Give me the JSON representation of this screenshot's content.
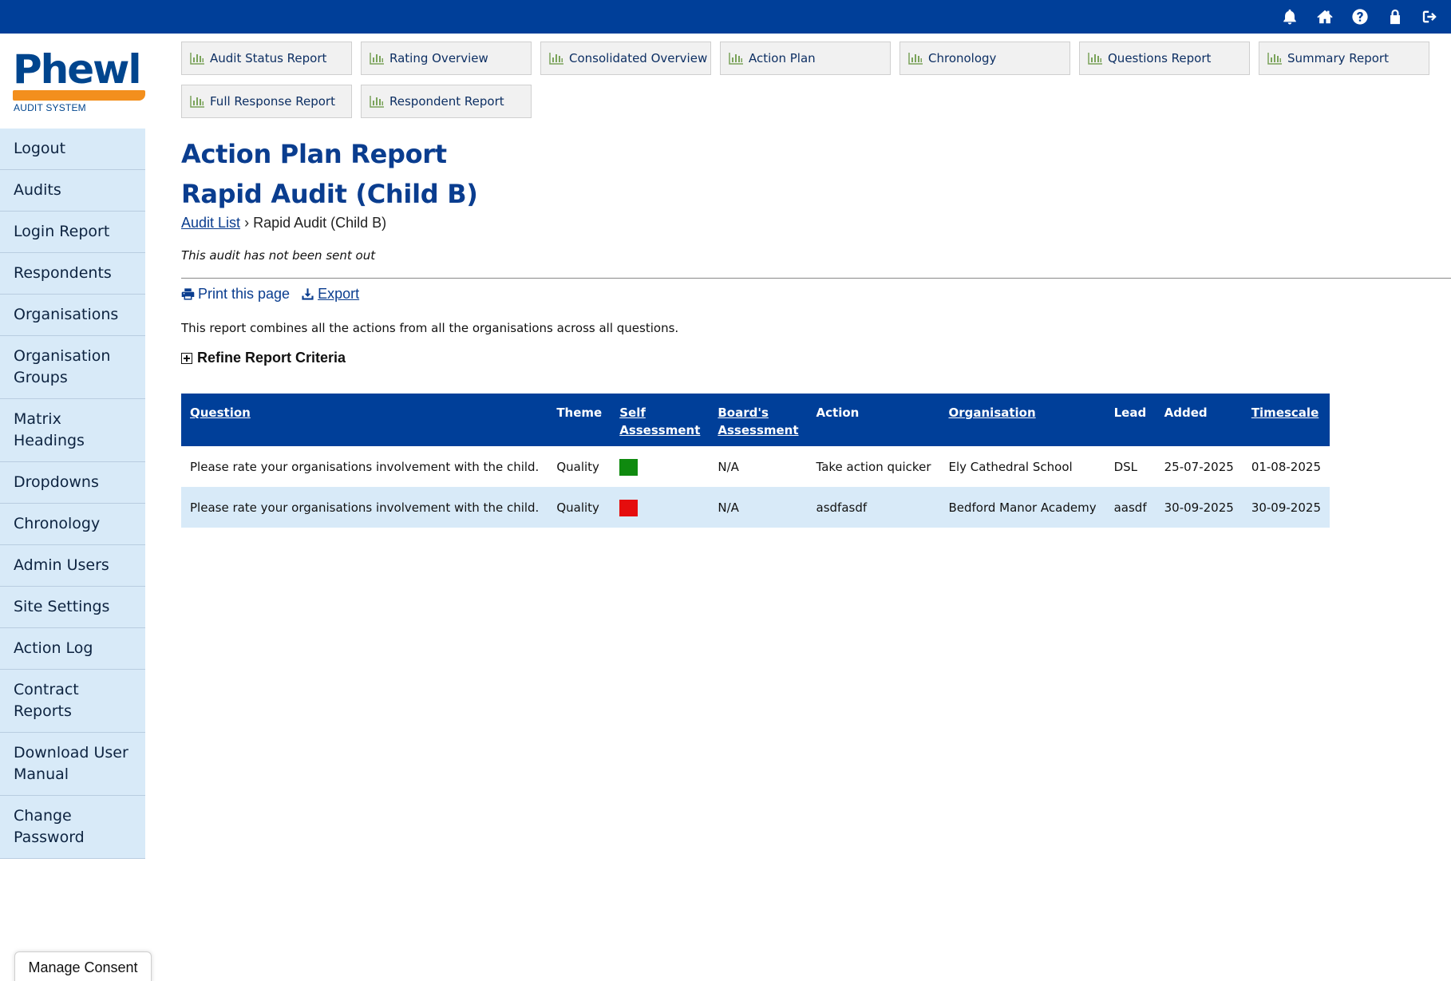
{
  "topbar": {
    "icons": [
      "bell-icon",
      "home-icon",
      "help-icon",
      "lock-icon",
      "sign-out-icon"
    ]
  },
  "logo": {
    "word": "Phewl",
    "subtitle": "AUDIT SYSTEM"
  },
  "sidebar": {
    "items": [
      {
        "label": "Logout"
      },
      {
        "label": "Audits"
      },
      {
        "label": "Login Report"
      },
      {
        "label": "Respondents"
      },
      {
        "label": "Organisations"
      },
      {
        "label": "Organisation Groups"
      },
      {
        "label": "Matrix Headings"
      },
      {
        "label": "Dropdowns"
      },
      {
        "label": "Chronology"
      },
      {
        "label": "Admin Users"
      },
      {
        "label": "Site Settings"
      },
      {
        "label": "Action Log"
      },
      {
        "label": "Contract Reports"
      },
      {
        "label": "Download User Manual"
      },
      {
        "label": "Change Password"
      }
    ]
  },
  "report_buttons": [
    {
      "label": "Audit Status Report"
    },
    {
      "label": "Rating Overview"
    },
    {
      "label": "Consolidated Overview"
    },
    {
      "label": "Action Plan"
    },
    {
      "label": "Chronology"
    },
    {
      "label": "Questions Report"
    },
    {
      "label": "Summary Report"
    },
    {
      "label": "Full Response Report"
    },
    {
      "label": "Respondent Report"
    }
  ],
  "page": {
    "title": "Action Plan Report",
    "audit_name": "Rapid Audit (Child B)",
    "breadcrumb_link": "Audit List",
    "breadcrumb_sep": "›",
    "breadcrumb_current": "Rapid Audit (Child B)",
    "status_note": "This audit has not been sent out",
    "print_label": "Print this page",
    "export_label": "Export",
    "description": "This report combines all the actions from all the organisations across all questions.",
    "refine_label": "Refine Report Criteria"
  },
  "table": {
    "headers": {
      "question": "Question",
      "theme": "Theme",
      "self_line1": "Self",
      "self_line2": "Assessment",
      "board_line1": "Board's",
      "board_line2": "Assessment",
      "action": "Action",
      "organisation": "Organisation",
      "lead": "Lead",
      "added": "Added",
      "timescale": "Timescale"
    },
    "rows": [
      {
        "question": "Please rate your organisations involvement with the child.",
        "theme": "Quality",
        "self_assessment_color": "#0f8a0f",
        "board_assessment": "N/A",
        "action": "Take action quicker",
        "organisation": "Ely Cathedral School",
        "lead": "DSL",
        "added": "25-07-2025",
        "timescale": "01-08-2025"
      },
      {
        "question": "Please rate your organisations involvement with the child.",
        "theme": "Quality",
        "self_assessment_color": "#e50d0d",
        "board_assessment": "N/A",
        "action": "asdfasdf",
        "organisation": "Bedford Manor Academy",
        "lead": "aasdf",
        "added": "30-09-2025",
        "timescale": "30-09-2025"
      }
    ]
  },
  "consent": {
    "label": "Manage Consent"
  },
  "colors": {
    "topbar": "#003f99",
    "brand_blue": "#00458e",
    "brand_orange": "#f38f1d",
    "sidebar_bg": "#d8eaf8",
    "title_blue": "#0a3d8f"
  }
}
